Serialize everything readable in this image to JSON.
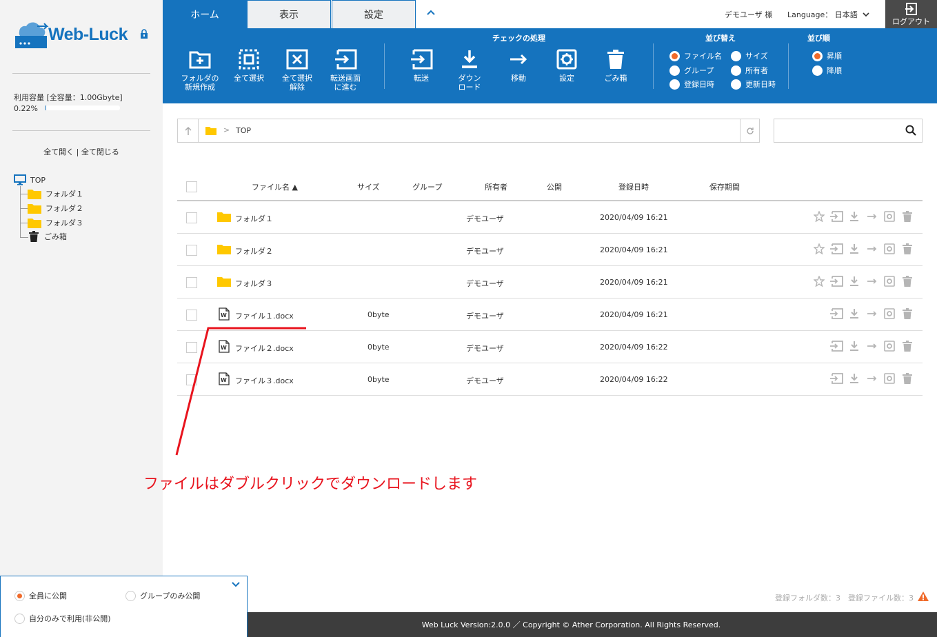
{
  "sidebar": {
    "logo_text": "Web-Luck",
    "usage_label": "利用容量 [全容量：1.00Gbyte]",
    "usage_percent": "0.22%",
    "usage_fraction": 0.0022,
    "expand_all": "全て開く",
    "separator": "|",
    "collapse_all": "全て閉じる",
    "tree": {
      "root": "TOP",
      "items": [
        "フォルダ１",
        "フォルダ２",
        "フォルダ３",
        "ごみ箱"
      ]
    }
  },
  "header": {
    "tabs": [
      "ホーム",
      "表示",
      "設定"
    ],
    "active_tab": 0,
    "user": "デモユーザ 様",
    "language_label": "Language：",
    "language_value": "日本語",
    "logout": "ログアウト"
  },
  "ribbon": {
    "buttons_left": [
      {
        "l1": "フォルダの",
        "l2": "新規作成"
      },
      {
        "l1": "全て選択",
        "l2": ""
      },
      {
        "l1": "全て選択",
        "l2": "解除"
      },
      {
        "l1": "転送画面",
        "l2": "に進む"
      }
    ],
    "check_title": "チェックの処理",
    "buttons_check": [
      {
        "l1": "転送",
        "l2": ""
      },
      {
        "l1": "ダウン",
        "l2": "ロード"
      },
      {
        "l1": "移動",
        "l2": ""
      },
      {
        "l1": "設定",
        "l2": ""
      },
      {
        "l1": "ごみ箱",
        "l2": ""
      }
    ],
    "sort_title": "並び替え",
    "sort_options": [
      "ファイル名",
      "サイズ",
      "グループ",
      "所有者",
      "登録日時",
      "更新日時"
    ],
    "sort_selected": "ファイル名",
    "order_title": "並び順",
    "order_options": [
      "昇順",
      "降順"
    ],
    "order_selected": "昇順"
  },
  "path": {
    "current": "TOP"
  },
  "search": {
    "placeholder": "",
    "value": ""
  },
  "table": {
    "headers": {
      "name": "ファイル名 ▲",
      "size": "サイズ",
      "group": "グループ",
      "owner": "所有者",
      "public": "公開",
      "created": "登録日時",
      "retention": "保存期間"
    },
    "rows": [
      {
        "type": "folder",
        "name": "フォルダ１",
        "size": "",
        "owner": "デモユーザ",
        "created": "2020/04/09 16:21"
      },
      {
        "type": "folder",
        "name": "フォルダ２",
        "size": "",
        "owner": "デモユーザ",
        "created": "2020/04/09 16:21"
      },
      {
        "type": "folder",
        "name": "フォルダ３",
        "size": "",
        "owner": "デモユーザ",
        "created": "2020/04/09 16:21"
      },
      {
        "type": "file",
        "name": "ファイル１.docx",
        "size": "0byte",
        "owner": "デモユーザ",
        "created": "2020/04/09 16:21"
      },
      {
        "type": "file",
        "name": "ファイル２.docx",
        "size": "0byte",
        "owner": "デモユーザ",
        "created": "2020/04/09 16:22"
      },
      {
        "type": "file",
        "name": "ファイル３.docx",
        "size": "0byte",
        "owner": "デモユーザ",
        "created": "2020/04/09 16:22"
      }
    ]
  },
  "annotation": "ファイルはダブルクリックでダウンロードします",
  "status": {
    "counts": "登録フォルダ数：3　登録ファイル数：3"
  },
  "footer": "Web Luck Version:2.0.0 ／ Copyright © Ather Corporation. All Rights Reserved.",
  "publish": {
    "options": [
      "全員に公開",
      "グループのみ公開",
      "自分のみで利用(非公開)"
    ],
    "selected": "全員に公開"
  },
  "colors": {
    "brand": "#1573be",
    "accent": "#f06a2a",
    "folder": "#ffc800",
    "annotation": "#e8141e"
  }
}
